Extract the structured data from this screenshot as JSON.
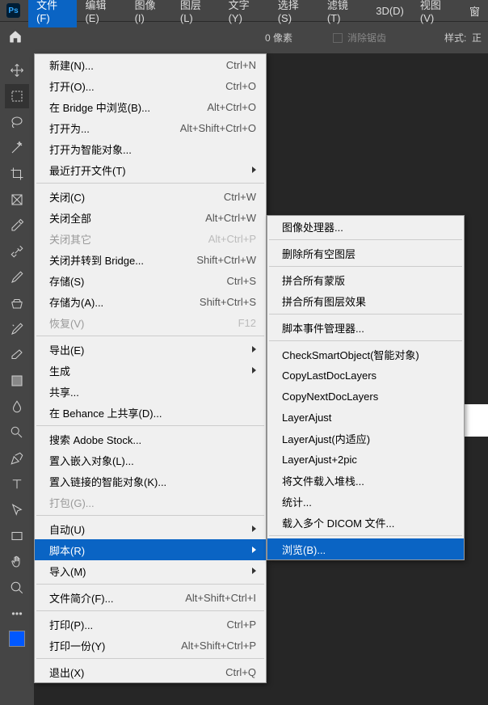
{
  "app": {
    "name": "Ps"
  },
  "menubar": {
    "file": "文件(F)",
    "edit": "编辑(E)",
    "image": "图像(I)",
    "layer": "图层(L)",
    "text": "文字(Y)",
    "select": "选择(S)",
    "filter": "滤镜(T)",
    "threed": "3D(D)",
    "view": "视图(V)",
    "window": "窗"
  },
  "toolbar": {
    "pixel_zero": "0",
    "pixel_unit": "像素",
    "anti_alias": "消除锯齿",
    "style": "样式:",
    "style_val": "正"
  },
  "file_menu": {
    "new": {
      "label": "新建(N)...",
      "shortcut": "Ctrl+N"
    },
    "open": {
      "label": "打开(O)...",
      "shortcut": "Ctrl+O"
    },
    "browse_bridge": {
      "label": "在 Bridge 中浏览(B)...",
      "shortcut": "Alt+Ctrl+O"
    },
    "open_as": {
      "label": "打开为...",
      "shortcut": "Alt+Shift+Ctrl+O"
    },
    "open_smart": {
      "label": "打开为智能对象..."
    },
    "recent": {
      "label": "最近打开文件(T)"
    },
    "close": {
      "label": "关闭(C)",
      "shortcut": "Ctrl+W"
    },
    "close_all": {
      "label": "关闭全部",
      "shortcut": "Alt+Ctrl+W"
    },
    "close_others": {
      "label": "关闭其它",
      "shortcut": "Alt+Ctrl+P"
    },
    "close_goto_bridge": {
      "label": "关闭并转到 Bridge...",
      "shortcut": "Shift+Ctrl+W"
    },
    "save": {
      "label": "存储(S)",
      "shortcut": "Ctrl+S"
    },
    "save_as": {
      "label": "存储为(A)...",
      "shortcut": "Shift+Ctrl+S"
    },
    "revert": {
      "label": "恢复(V)",
      "shortcut": "F12"
    },
    "export": {
      "label": "导出(E)"
    },
    "generate": {
      "label": "生成"
    },
    "share": {
      "label": "共享..."
    },
    "behance": {
      "label": "在 Behance 上共享(D)..."
    },
    "search_stock": {
      "label": "搜索 Adobe Stock..."
    },
    "place_embedded": {
      "label": "置入嵌入对象(L)..."
    },
    "place_linked": {
      "label": "置入链接的智能对象(K)..."
    },
    "package": {
      "label": "打包(G)..."
    },
    "automate": {
      "label": "自动(U)"
    },
    "scripts": {
      "label": "脚本(R)"
    },
    "import": {
      "label": "导入(M)"
    },
    "file_info": {
      "label": "文件简介(F)...",
      "shortcut": "Alt+Shift+Ctrl+I"
    },
    "print": {
      "label": "打印(P)...",
      "shortcut": "Ctrl+P"
    },
    "print_one": {
      "label": "打印一份(Y)",
      "shortcut": "Alt+Shift+Ctrl+P"
    },
    "exit": {
      "label": "退出(X)",
      "shortcut": "Ctrl+Q"
    }
  },
  "scripts_submenu": {
    "image_processor": "图像处理器...",
    "delete_empty": "删除所有空图层",
    "flatten_masks": "拼合所有蒙版",
    "flatten_effects": "拼合所有图层效果",
    "event_manager": "脚本事件管理器...",
    "check_smart": "CheckSmartObject(智能对象)",
    "copy_last": "CopyLastDocLayers",
    "copy_next": "CopyNextDocLayers",
    "layer_adjust": "LayerAjust",
    "layer_adjust_adaptive": "LayerAjust(内适应)",
    "layer_adjust_2pic": "LayerAjust+2pic",
    "load_stack": "将文件载入堆栈...",
    "statistics": "统计...",
    "load_dicom": "载入多个 DICOM 文件...",
    "browse": "浏览(B)..."
  }
}
